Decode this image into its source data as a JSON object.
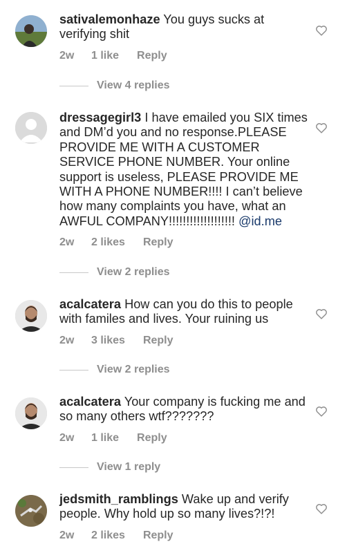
{
  "comments": [
    {
      "username": "sativalemonhaze",
      "text": "You guys sucks at verifying shit",
      "mention": "",
      "age": "2w",
      "likes": "1 like",
      "reply_label": "Reply",
      "view_replies": "View 4 replies"
    },
    {
      "username": "dressagegirl3",
      "text": "I have emailed you SIX times and DM’d you and no response.PLEASE PROVIDE ME WITH A CUSTOMER SERVICE PHONE NUMBER. Your online support is useless, PLEASE PROVIDE ME WITH A PHONE NUMBER!!!! I can’t believe how many complaints you have, what an AWFUL COMPANY!!!!!!!!!!!!!!!!!!! ",
      "mention": "@id.me",
      "age": "2w",
      "likes": "2 likes",
      "reply_label": "Reply",
      "view_replies": "View 2 replies"
    },
    {
      "username": "acalcatera",
      "text": "How can you do this to people with familes and lives. Your ruining us",
      "mention": "",
      "age": "2w",
      "likes": "3 likes",
      "reply_label": "Reply",
      "view_replies": "View 2 replies"
    },
    {
      "username": "acalcatera",
      "text": "Your company is fucking me and so many others wtf???????",
      "mention": "",
      "age": "2w",
      "likes": "1 like",
      "reply_label": "Reply",
      "view_replies": "View 1 reply"
    },
    {
      "username": "jedsmith_ramblings",
      "text": "Wake up and verify people. Why hold up so many lives?!?!",
      "mention": "",
      "age": "2w",
      "likes": "2 likes",
      "reply_label": "Reply",
      "view_replies": ""
    }
  ],
  "icons": {
    "like": "heart-outline-icon"
  },
  "colors": {
    "text": "#262626",
    "meta": "#8e8e8e",
    "mention": "#1a3a6b"
  }
}
